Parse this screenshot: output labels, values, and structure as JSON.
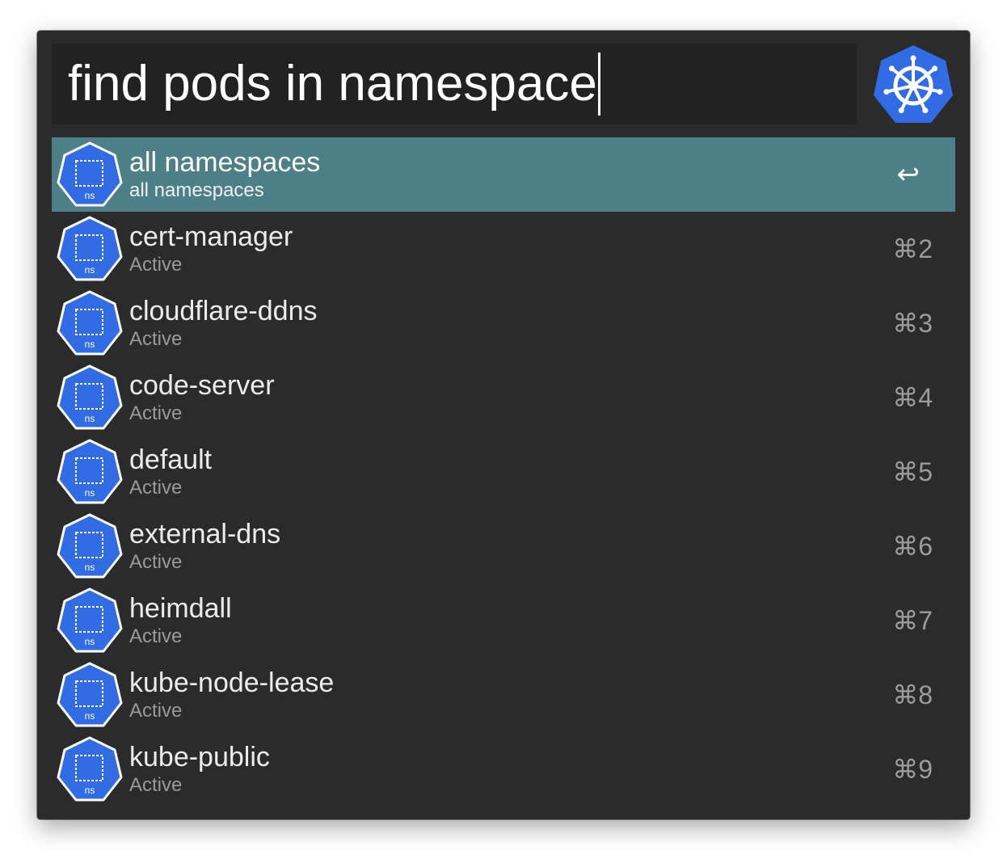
{
  "search": {
    "query": "find pods in namespace"
  },
  "logo": {
    "icon": "kubernetes-helm-icon",
    "color": "#326ce5"
  },
  "colors": {
    "window_bg": "#2b2b2b",
    "search_bg": "#222222",
    "selected_row": "#4d7f88",
    "icon_blue": "#326ce5"
  },
  "results": [
    {
      "title": "all namespaces",
      "subtitle": "all namespaces",
      "shortcut": "↩",
      "icon_label": "ns",
      "selected": true
    },
    {
      "title": "cert-manager",
      "subtitle": "Active",
      "shortcut": "⌘2",
      "icon_label": "ns"
    },
    {
      "title": "cloudflare-ddns",
      "subtitle": "Active",
      "shortcut": "⌘3",
      "icon_label": "ns"
    },
    {
      "title": "code-server",
      "subtitle": "Active",
      "shortcut": "⌘4",
      "icon_label": "ns"
    },
    {
      "title": "default",
      "subtitle": "Active",
      "shortcut": "⌘5",
      "icon_label": "ns"
    },
    {
      "title": "external-dns",
      "subtitle": "Active",
      "shortcut": "⌘6",
      "icon_label": "ns"
    },
    {
      "title": "heimdall",
      "subtitle": "Active",
      "shortcut": "⌘7",
      "icon_label": "ns"
    },
    {
      "title": "kube-node-lease",
      "subtitle": "Active",
      "shortcut": "⌘8",
      "icon_label": "ns"
    },
    {
      "title": "kube-public",
      "subtitle": "Active",
      "shortcut": "⌘9",
      "icon_label": "ns"
    }
  ]
}
